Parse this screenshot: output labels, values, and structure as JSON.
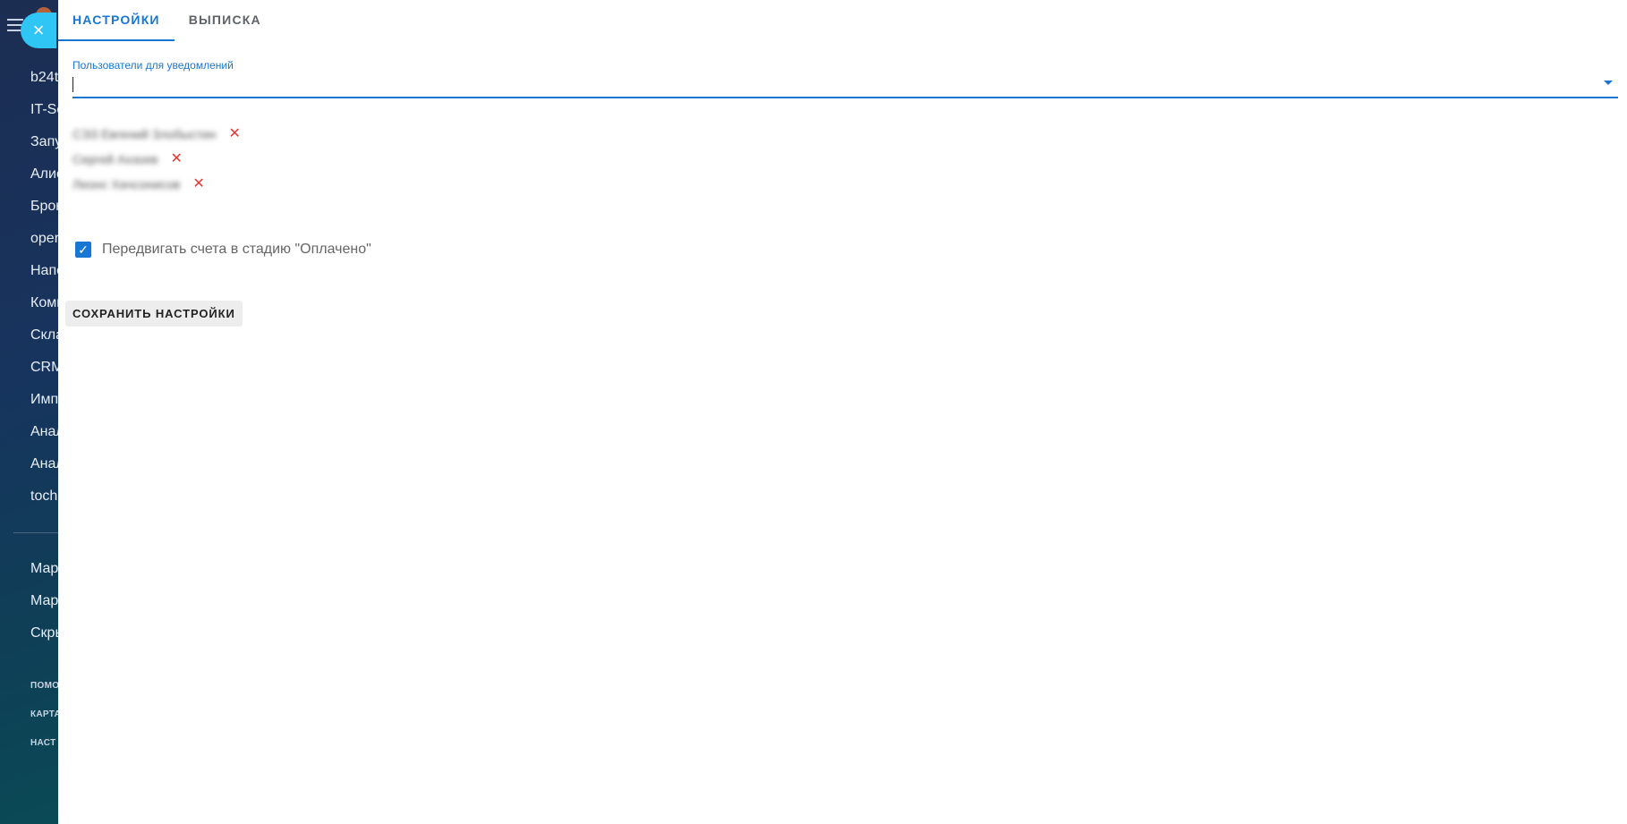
{
  "sidebar": {
    "menu_icon": "hamburger-icon",
    "items": [
      {
        "label": "b24t"
      },
      {
        "label": "IT-So"
      },
      {
        "label": "Запу"
      },
      {
        "label": "Алис"
      },
      {
        "label": "Брон"
      },
      {
        "label": "oper"
      },
      {
        "label": "Напс"
      },
      {
        "label": "Комп"
      },
      {
        "label": "Скла"
      },
      {
        "label": "CRM"
      },
      {
        "label": "Имп"
      },
      {
        "label": "Анал"
      },
      {
        "label": "Анал"
      },
      {
        "label": "tochl"
      },
      {
        "label": "Мар"
      },
      {
        "label": "Мар"
      },
      {
        "label": "Скры"
      }
    ],
    "small_items": [
      {
        "label": "ПОМО"
      },
      {
        "label": "КАРТА"
      },
      {
        "label": "НАСТ"
      }
    ]
  },
  "close_button": {
    "icon": "close-icon",
    "glyph": "×"
  },
  "tabs": [
    {
      "label": "НАСТРОЙКИ",
      "active": true
    },
    {
      "label": "ВЫПИСКА",
      "active": false
    }
  ],
  "notify_field": {
    "label": "Пользователи для уведомлений",
    "value": "",
    "icon": "dropdown-arrow-icon"
  },
  "users": [
    {
      "name": "СЭЗ Евгений Злобыстин"
    },
    {
      "name": "Сергей Ахзоев"
    },
    {
      "name": "Леонс Хачсонисов"
    }
  ],
  "remove_glyph": "✕",
  "move_invoices": {
    "checked": true,
    "label": "Передвигать счета в стадию \"Оплачено\""
  },
  "save_button": {
    "label": "СОХРАНИТЬ НАСТРОЙКИ"
  },
  "colors": {
    "accent": "#1976d2",
    "close_button": "#2fc6f6",
    "remove": "#e53935"
  }
}
